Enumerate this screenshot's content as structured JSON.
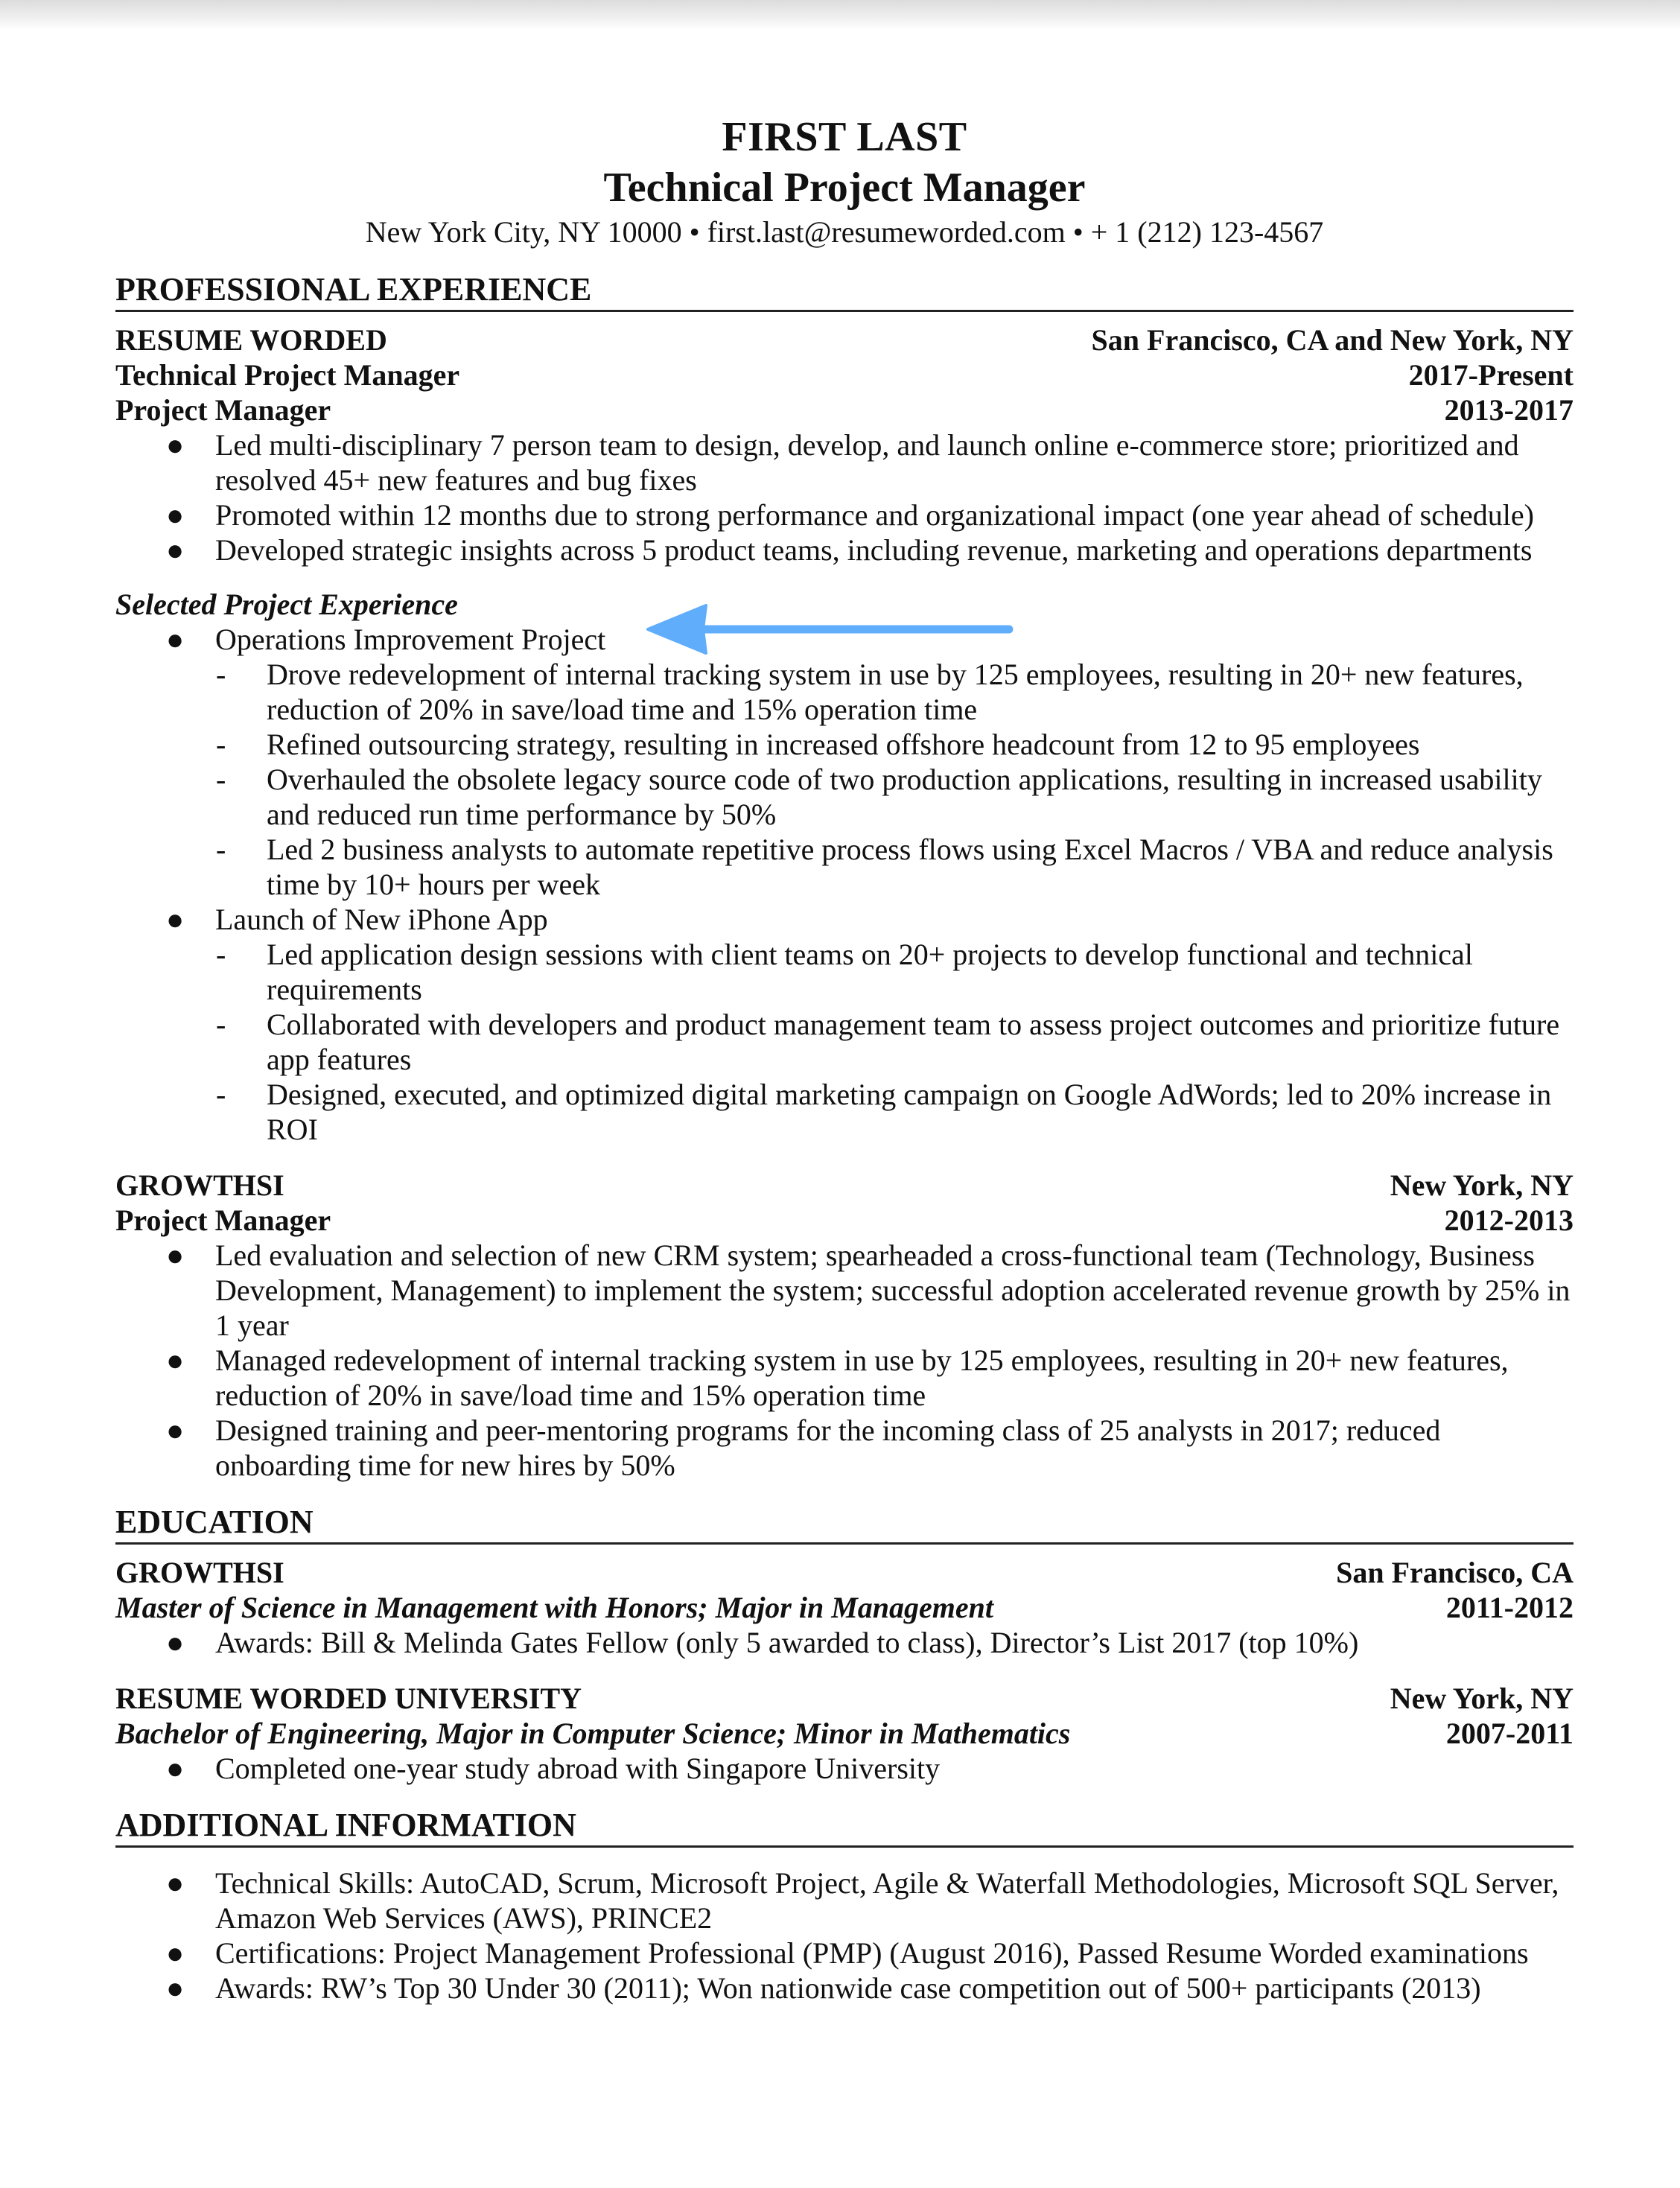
{
  "header": {
    "name": "FIRST LAST",
    "headline": "Technical Project Manager",
    "contact": "New York City, NY 10000 • first.last@resumeworded.com • + 1 (212) 123-4567"
  },
  "experience": {
    "title": "PROFESSIONAL EXPERIENCE",
    "jobs": [
      {
        "company": "RESUME WORDED",
        "location": "San Francisco, CA and New York, NY",
        "roles": [
          {
            "title": "Technical Project Manager",
            "dates": "2017-Present"
          },
          {
            "title": "Project Manager",
            "dates": "2013-2017"
          }
        ],
        "bullets": [
          "Led multi-disciplinary 7 person team to design, develop, and launch online e-commerce store; prioritized and resolved 45+ new features and bug fixes",
          "Promoted within 12 months due to strong performance and organizational impact (one year ahead of schedule)",
          "Developed strategic insights across 5 product teams, including revenue, marketing and operations departments"
        ],
        "selected_projects": {
          "heading": "Selected Project Experience",
          "projects": [
            {
              "name": "Operations Improvement Project",
              "items": [
                "Drove redevelopment of internal tracking system in use by 125 employees, resulting in 20+ new features, reduction of 20% in save/load time and 15% operation time",
                "Refined outsourcing strategy, resulting in increased offshore headcount from 12 to 95 employees",
                "Overhauled the obsolete legacy source code of two production applications, resulting in increased usability and reduced run time performance by 50%",
                "Led 2 business analysts to automate repetitive process flows using Excel Macros / VBA and reduce analysis time by 10+ hours per week"
              ]
            },
            {
              "name": "Launch of New iPhone App",
              "items": [
                "Led application design sessions with client teams on 20+ projects to develop functional and technical requirements",
                "Collaborated with developers and product management team to assess project outcomes and prioritize future app features",
                "Designed, executed, and optimized digital marketing campaign on Google AdWords; led to 20% increase in ROI"
              ]
            }
          ]
        }
      },
      {
        "company": "GROWTHSI",
        "location": "New York, NY",
        "roles": [
          {
            "title": "Project Manager",
            "dates": "2012-2013"
          }
        ],
        "bullets": [
          "Led evaluation and selection of new CRM system; spearheaded a cross-functional team (Technology, Business Development, Management) to implement the system; successful adoption accelerated revenue growth by 25% in 1 year",
          "Managed redevelopment of internal tracking system in use by 125 employees, resulting in 20+ new features, reduction of 20% in save/load time and 15% operation time",
          "Designed training and peer-mentoring programs for the incoming class of 25 analysts in 2017; reduced onboarding time for new hires by 50%"
        ]
      }
    ]
  },
  "education": {
    "title": "EDUCATION",
    "schools": [
      {
        "school": "GROWTHSI",
        "location": "San Francisco, CA",
        "degree": "Master of Science in Management with Honors; Major in Management",
        "dates": "2011-2012",
        "bullets": [
          "Awards: Bill & Melinda Gates Fellow (only 5 awarded to class), Director’s List 2017 (top 10%)"
        ]
      },
      {
        "school": "RESUME WORDED UNIVERSITY",
        "location": "New York, NY",
        "degree": "Bachelor of Engineering, Major in Computer Science; Minor in Mathematics",
        "dates": "2007-2011",
        "bullets": [
          "Completed one-year study abroad with Singapore University"
        ]
      }
    ]
  },
  "additional": {
    "title": "ADDITIONAL INFORMATION",
    "bullets": [
      "Technical Skills: AutoCAD, Scrum, Microsoft Project, Agile & Waterfall Methodologies, Microsoft SQL Server, Amazon Web Services (AWS), PRINCE2",
      "Certifications: Project Management Professional (PMP) (August 2016), Passed Resume Worded examinations",
      "Awards: RW’s Top 30 Under 30 (2011); Won nationwide case competition out of 500+ participants (2013)"
    ]
  },
  "markers": {
    "bullet": "●",
    "dash": "-"
  },
  "annotation": {
    "icon": "left-arrow-icon",
    "color": "#5fadfb"
  }
}
